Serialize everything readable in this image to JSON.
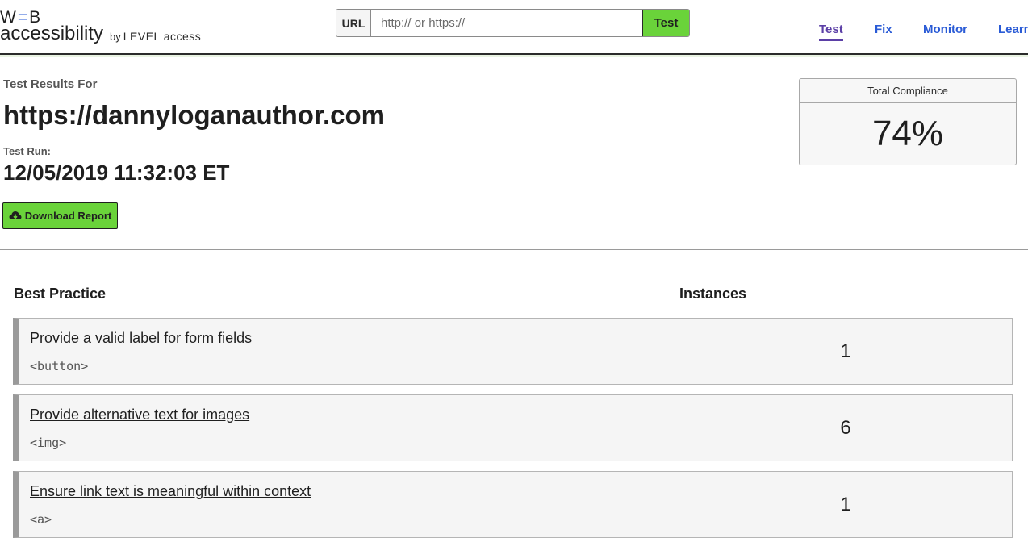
{
  "header": {
    "logo": {
      "web": "WEB",
      "accessibility": "accessibility",
      "by": "by",
      "brand": "LEVEL access"
    },
    "url_label": "URL",
    "url_placeholder": "http:// or https://",
    "test_button": "Test",
    "nav": [
      {
        "label": "Test",
        "active": true
      },
      {
        "label": "Fix",
        "active": false
      },
      {
        "label": "Monitor",
        "active": false
      },
      {
        "label": "Learn",
        "active": false
      }
    ]
  },
  "results": {
    "heading": "Test Results For",
    "site_url": "https://dannyloganauthor.com",
    "test_run_label": "Test Run:",
    "test_run_date": "12/05/2019 11:32:03 ET",
    "download_label": "Download Report"
  },
  "compliance": {
    "title": "Total Compliance",
    "value": "74%"
  },
  "table": {
    "col_practice": "Best Practice",
    "col_instances": "Instances",
    "rows": [
      {
        "title": "Provide a valid label for form fields",
        "code": "<button>",
        "instances": "1"
      },
      {
        "title": "Provide alternative text for images",
        "code": "<img>",
        "instances": "6"
      },
      {
        "title": "Ensure link text is meaningful within context",
        "code": "<a>",
        "instances": "1"
      }
    ]
  },
  "colors": {
    "accent_green": "#6ad33a",
    "link_blue": "#2a5bd6",
    "active_purple": "#5b3fa6"
  },
  "icons": {
    "download": "cloud-download-icon"
  }
}
